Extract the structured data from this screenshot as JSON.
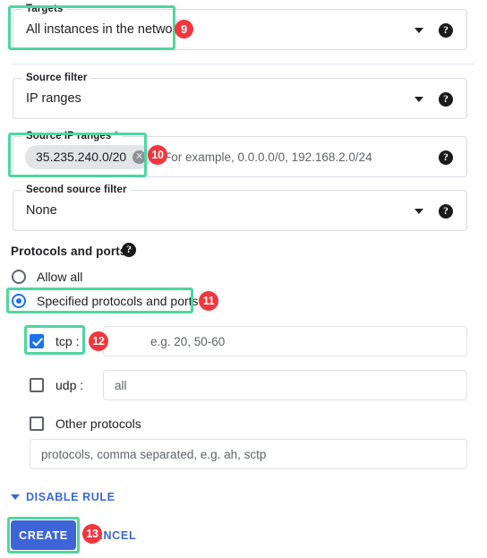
{
  "fields": {
    "targets": {
      "label": "Targets",
      "value": "All instances in the network",
      "help_icon": "help-circle-icon",
      "caret_icon": "chevron-down-icon"
    },
    "source_filter": {
      "label": "Source filter",
      "value": "IP ranges",
      "help_icon": "help-circle-icon",
      "caret_icon": "chevron-down-icon"
    },
    "source_ip_ranges": {
      "label": "Source IP ranges *",
      "chip": "35.235.240.0/20",
      "chip_remove_icon": "close-circle-icon",
      "placeholder": "For example, 0.0.0.0/0, 192.168.2.0/24",
      "help_icon": "help-circle-icon"
    },
    "second_source_filter": {
      "label": "Second source filter",
      "value": "None",
      "help_icon": "help-circle-icon",
      "caret_icon": "chevron-down-icon"
    }
  },
  "protocols_section": {
    "heading": "Protocols and ports",
    "help_icon": "help-circle-icon",
    "radios": [
      {
        "label": "Allow all",
        "checked": false
      },
      {
        "label": "Specified protocols and ports",
        "checked": true
      }
    ],
    "tcp": {
      "label": "tcp :",
      "checked": true,
      "placeholder": "e.g. 20, 50-60"
    },
    "udp": {
      "label": "udp :",
      "checked": false,
      "placeholder": "all"
    },
    "other": {
      "label": "Other protocols",
      "checked": false,
      "placeholder": "protocols, comma separated, e.g. ah, sctp"
    }
  },
  "footer": {
    "disable_rule_label": "DISABLE RULE",
    "disable_rule_icon": "chevron-down-icon",
    "create_label": "CREATE",
    "cancel_label": "CANCEL"
  },
  "annotations": {
    "badges": [
      {
        "number": "9"
      },
      {
        "number": "10"
      },
      {
        "number": "11"
      },
      {
        "number": "12"
      },
      {
        "number": "13"
      }
    ],
    "highlight_color": "#4ed6a1",
    "badge_color": "#f2363c"
  },
  "colors": {
    "accent_blue": "#1a73e8",
    "button_blue": "#3d65d8",
    "link_blue": "#3b68d8",
    "border_gray": "#dadce0",
    "text_primary": "#202124",
    "text_secondary": "#5f6368"
  }
}
